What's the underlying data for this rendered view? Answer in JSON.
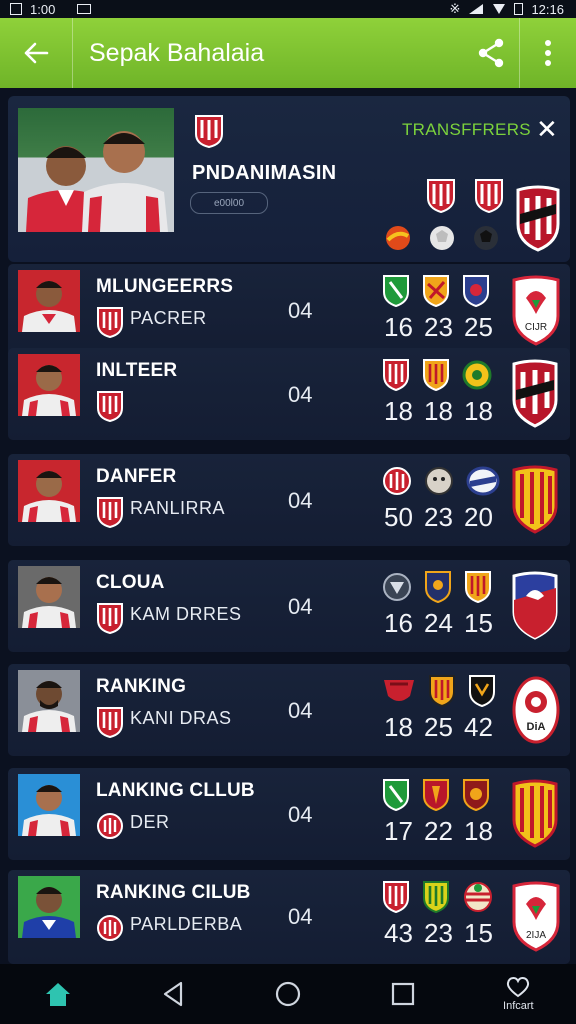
{
  "status_bar": {
    "time": "12:16",
    "left_time": "1:00"
  },
  "app_bar": {
    "title": "Sepak Bahalaia"
  },
  "hero": {
    "name": "PNDANIMASIN",
    "pill": "e00l00",
    "transfers_label": "TRANSFFRERS"
  },
  "rows": [
    {
      "name": "MLUNGEERRS",
      "sub": "PACRER",
      "num": "04",
      "stats": [
        "16",
        "23",
        "25"
      ],
      "big_crest_text": "CIJR"
    },
    {
      "name": "INLTEER",
      "sub": "",
      "num": "04",
      "stats": [
        "18",
        "18",
        "18"
      ],
      "big_crest_text": ""
    },
    {
      "name": "DANFER",
      "sub": "RANLIRRA",
      "num": "04",
      "stats": [
        "50",
        "23",
        "20"
      ],
      "big_crest_text": ""
    },
    {
      "name": "CLOUA",
      "sub": "KAM DRRES",
      "num": "04",
      "stats": [
        "16",
        "24",
        "15"
      ],
      "big_crest_text": ""
    },
    {
      "name": "RANKING",
      "sub": "KANI DRAS",
      "num": "04",
      "stats": [
        "18",
        "25",
        "42"
      ],
      "big_crest_text": "DiA"
    },
    {
      "name": "LANKING CLLUB",
      "sub": "DER",
      "num": "04",
      "stats": [
        "17",
        "22",
        "18"
      ],
      "big_crest_text": ""
    },
    {
      "name": "RANKING CILUB",
      "sub": "PARLDERBA",
      "num": "04",
      "stats": [
        "43",
        "23",
        "15"
      ],
      "big_crest_text": "2IJA"
    }
  ],
  "nav": {
    "favorites_label": "Infcart"
  },
  "colors": {
    "accent_green": "#7ac232",
    "panel": "#18233a",
    "background": "#0b1120"
  }
}
